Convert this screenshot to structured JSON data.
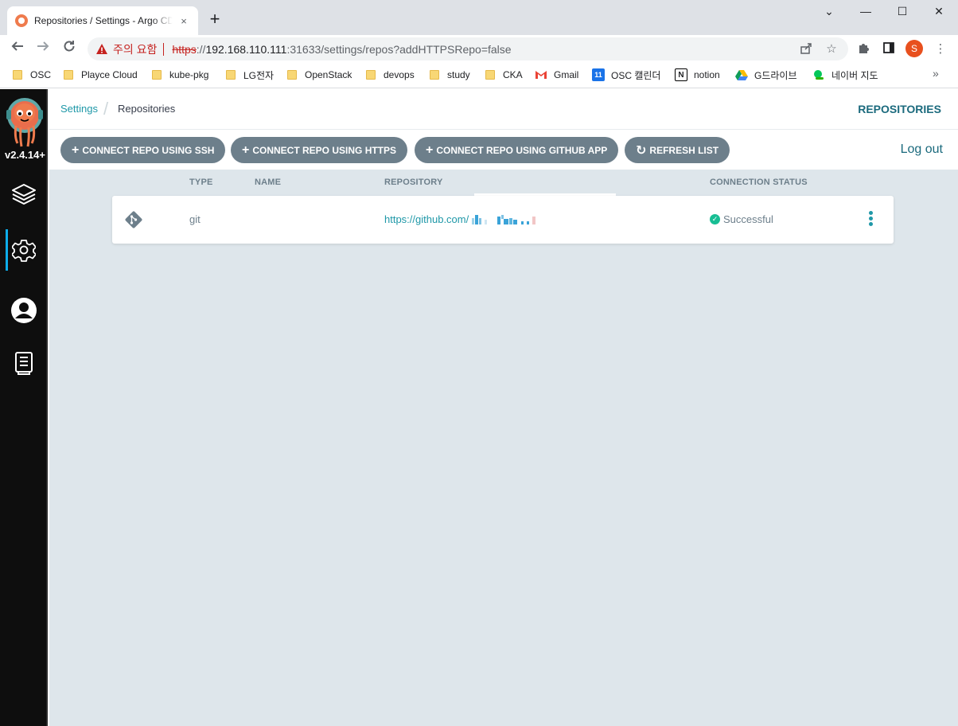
{
  "browser": {
    "tab_title": "Repositories / Settings - Argo CD",
    "tab_close": "×",
    "new_tab": "+",
    "window_controls": {
      "minimize": "⌄",
      "maximize": "—",
      "restore": "☐",
      "close": "✕"
    },
    "security_label": "주의 요함",
    "url": {
      "scheme": "https",
      "sep": "://",
      "host": "192.168.110.111",
      "rest": ":31633/settings/repos?addHTTPSRepo=false"
    },
    "profile_initial": "S",
    "bookmarks": [
      {
        "label": "OSC",
        "icon": "folder-icon"
      },
      {
        "label": "Playce Cloud",
        "icon": "folder-icon"
      },
      {
        "label": "kube-pkg",
        "icon": "folder-icon"
      },
      {
        "label": "LG전자",
        "icon": "folder-icon"
      },
      {
        "label": "OpenStack",
        "icon": "folder-icon"
      },
      {
        "label": "devops",
        "icon": "folder-icon"
      },
      {
        "label": "study",
        "icon": "folder-icon"
      },
      {
        "label": "CKA",
        "icon": "folder-icon"
      },
      {
        "label": "Gmail",
        "icon": "gmail-icon"
      },
      {
        "label": "OSC 캘린더",
        "icon": "calendar-icon"
      },
      {
        "label": "notion",
        "icon": "notion-icon"
      },
      {
        "label": "G드라이브",
        "icon": "drive-icon"
      },
      {
        "label": "네이버 지도",
        "icon": "naver-map-icon"
      }
    ],
    "bookmarks_more": "»",
    "calendar_day": "11"
  },
  "app": {
    "version": "v2.4.14+",
    "sidebar": [
      {
        "name": "applications",
        "icon": "layers-icon"
      },
      {
        "name": "settings",
        "icon": "gear-icon",
        "active": true
      },
      {
        "name": "user-info",
        "icon": "user-icon"
      },
      {
        "name": "documentation",
        "icon": "docs-icon"
      }
    ],
    "breadcrumb": {
      "parent": "Settings",
      "separator": "/",
      "current": "Repositories"
    },
    "page_title": "REPOSITORIES",
    "actions": {
      "connect_ssh": "CONNECT REPO USING SSH",
      "connect_https": "CONNECT REPO USING HTTPS",
      "connect_github_app": "CONNECT REPO USING GITHUB APP",
      "refresh": "REFRESH LIST",
      "plus_glyph": "+",
      "refresh_glyph": "↻"
    },
    "logout": "Log out",
    "table": {
      "headers": [
        "TYPE",
        "NAME",
        "REPOSITORY",
        "CONNECTION STATUS"
      ],
      "rows": [
        {
          "type": "git",
          "name": "",
          "repository": "https://github.com/",
          "status": "Successful",
          "status_glyph": "✓"
        }
      ]
    },
    "colors": {
      "accent": "#1f98a8",
      "button": "#6d7f8b",
      "success": "#18be94",
      "sidebar": "#0e0e0e",
      "content_bg": "#dee6eb"
    }
  }
}
